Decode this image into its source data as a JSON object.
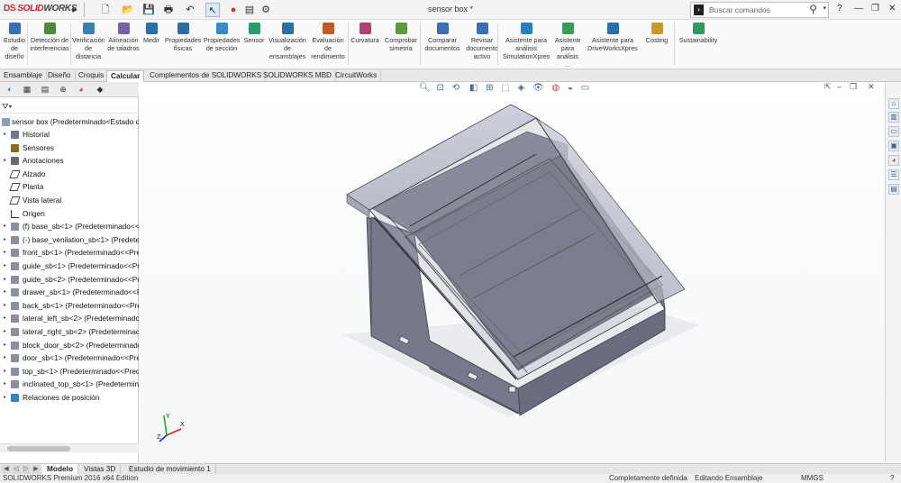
{
  "window": {
    "brand_ds": "DS",
    "brand_solid": "SOLID",
    "brand_works": "WORKS",
    "doc_title": "sensor box *",
    "search_placeholder": "Buscar comandos",
    "help_label": "?"
  },
  "ribbon": {
    "buttons": [
      {
        "label": "Estudio de diseño",
        "icon": "design-study-icon"
      },
      {
        "label": "Detección de interferencias",
        "icon": "interference-icon"
      },
      {
        "label": "Verificación de distancia",
        "icon": "clearance-icon"
      },
      {
        "label": "Alineación de taladros",
        "icon": "hole-align-icon"
      },
      {
        "label": "Medir",
        "icon": "measure-icon"
      },
      {
        "label": "Propiedades físicas",
        "icon": "mass-props-icon"
      },
      {
        "label": "Propiedades de sección",
        "icon": "section-props-icon"
      },
      {
        "label": "Sensor",
        "icon": "sensor-icon"
      },
      {
        "label": "Visualización de ensamblajes",
        "icon": "assembly-viz-icon"
      },
      {
        "label": "Evaluación de rendimiento",
        "icon": "performance-icon"
      },
      {
        "label": "Curvatura",
        "icon": "curvature-icon"
      },
      {
        "label": "Comprobar simetría",
        "icon": "symmetry-icon"
      },
      {
        "label": "Comparar documentos",
        "icon": "compare-icon"
      },
      {
        "label": "Revisar documento activo",
        "icon": "review-icon"
      },
      {
        "label": "Asistente para análisis SimulationXpress",
        "icon": "simxpress-icon"
      },
      {
        "label": "Asistente para análisis ...",
        "icon": "analysis-wizard-icon"
      },
      {
        "label": "Asistente para DriveWorksXpress",
        "icon": "driveworks-icon"
      },
      {
        "label": "Costing",
        "icon": "costing-icon"
      },
      {
        "label": "Sustainability",
        "icon": "sustainability-icon"
      }
    ]
  },
  "command_tabs": [
    "Ensamblaje",
    "Diseño",
    "Croquis",
    "Calcular",
    "Complementos de SOLIDWORKS",
    "SOLIDWORKS MBD",
    "CircuitWorks"
  ],
  "active_command_tab": "Calcular",
  "feature_tree": {
    "root": "sensor box  (Predeterminado<Estado de",
    "items": [
      {
        "label": "Historial",
        "expand": true,
        "icon": "history-icon"
      },
      {
        "label": "Sensores",
        "expand": false,
        "icon": "sensors-icon"
      },
      {
        "label": "Anotaciones",
        "expand": true,
        "icon": "annotations-icon"
      },
      {
        "label": "Alzado",
        "expand": false,
        "icon": "plane-icon"
      },
      {
        "label": "Planta",
        "expand": false,
        "icon": "plane-icon"
      },
      {
        "label": "Vista lateral",
        "expand": false,
        "icon": "plane-icon"
      },
      {
        "label": "Origen",
        "expand": false,
        "icon": "origin-icon"
      },
      {
        "label": "(f) base_sb<1> (Predeterminado<<P",
        "expand": true,
        "icon": "part-icon"
      },
      {
        "label": "(-) base_venilation_sb<1> (Predetermin",
        "expand": true,
        "icon": "part-icon"
      },
      {
        "label": "front_sb<1> (Predeterminado<<Pred",
        "expand": true,
        "icon": "part-icon"
      },
      {
        "label": "guide_sb<1> (Predeterminado<<Pre",
        "expand": true,
        "icon": "part-icon"
      },
      {
        "label": "guide_sb<2> (Predeterminado<<Pre",
        "expand": true,
        "icon": "part-icon"
      },
      {
        "label": "drawer_sb<1> (Predeterminado<<Pr",
        "expand": true,
        "icon": "part-icon"
      },
      {
        "label": "back_sb<1> (Predeterminado<<Pred",
        "expand": true,
        "icon": "part-icon"
      },
      {
        "label": "lateral_left_sb<2> (Predeterminado<",
        "expand": true,
        "icon": "part-icon"
      },
      {
        "label": "lateral_right_sb<2> (Predeterminado",
        "expand": true,
        "icon": "part-icon"
      },
      {
        "label": "block_door_sb<2> (Predeterminado<",
        "expand": true,
        "icon": "part-icon"
      },
      {
        "label": "door_sb<1> (Predeterminado<<Pred",
        "expand": true,
        "icon": "part-icon"
      },
      {
        "label": "top_sb<1> (Predeterminado<<Prede",
        "expand": true,
        "icon": "part-icon"
      },
      {
        "label": "inclinated_top_sb<1> (Predetermina",
        "expand": true,
        "icon": "part-icon"
      },
      {
        "label": "Relaciones de posición",
        "expand": true,
        "icon": "mates-icon"
      }
    ]
  },
  "bottom_tabs": [
    "Modelo",
    "Vistas 3D",
    "Estudio de movimiento 1"
  ],
  "active_bottom_tab": "Modelo",
  "status": {
    "edition": "SOLIDWORKS Premium 2016 x64 Edition",
    "definition": "Completamente definida",
    "mode": "Editando Ensamblaje",
    "units": "MMGS",
    "help": "?"
  },
  "triad": {
    "x": "X",
    "y": "Y",
    "z": "Z"
  },
  "colors": {
    "accent": "#d2232a",
    "model_fill": "#6e6f80",
    "model_glass": "#9a9aab"
  }
}
